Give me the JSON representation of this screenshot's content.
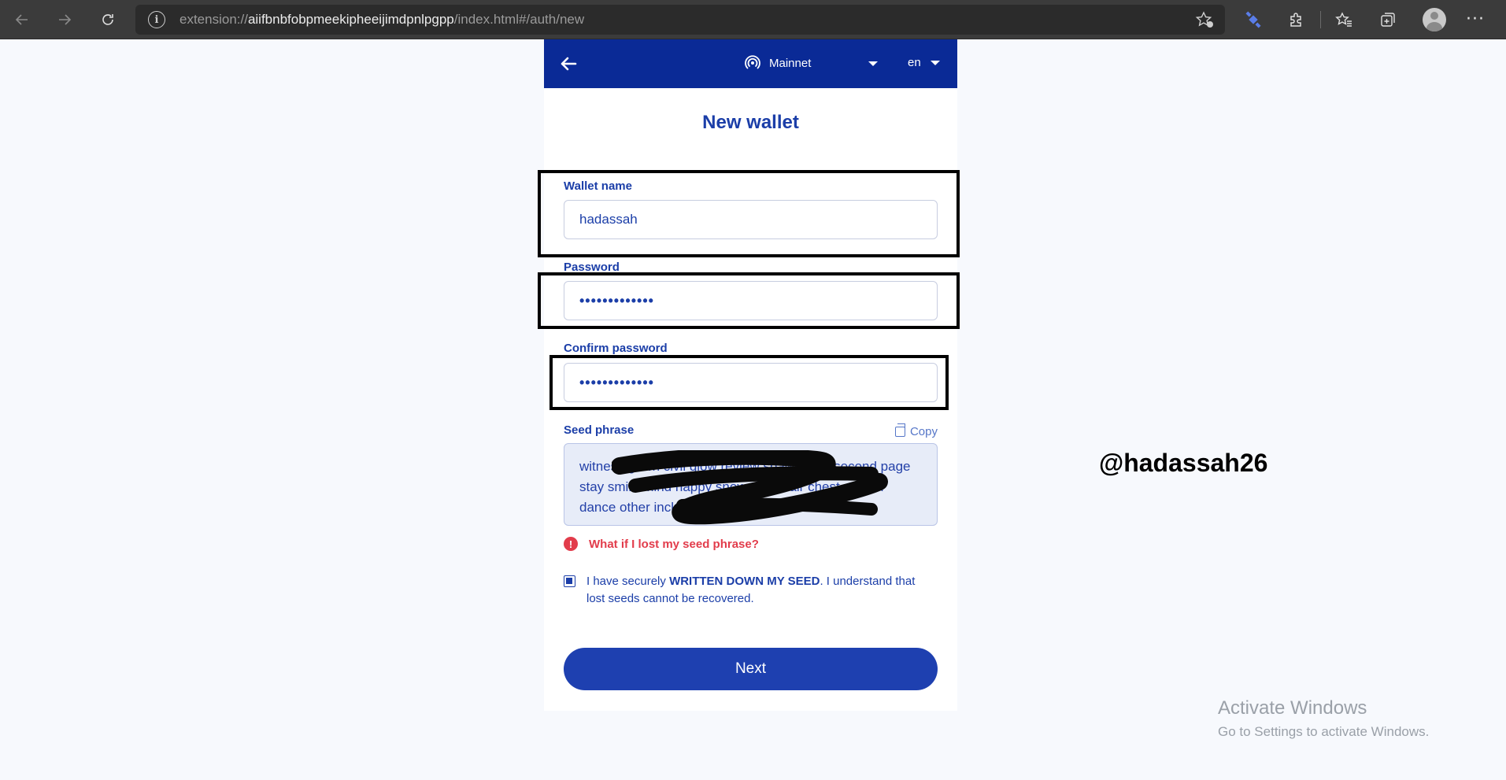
{
  "browser": {
    "url_scheme": "extension://",
    "url_host": "aiifbnbfobpmeekipheeijimdpnlpgpp",
    "url_path": "/index.html#/auth/new"
  },
  "header": {
    "network": "Mainnet",
    "language": "en"
  },
  "form": {
    "title": "New wallet",
    "wallet_name_label": "Wallet name",
    "wallet_name_value": "hadassah",
    "password_label": "Password",
    "password_value": "•••••••••••••",
    "confirm_label": "Confirm password",
    "confirm_value": "•••••••••••••",
    "seed_label": "Seed phrase",
    "copy_label": "Copy",
    "seed_value": "witness gown civil glow review spawn lake second page stay smile mind happy snow two chair chest mother dance other include lamp tank",
    "lost_seed_link": "What if I lost my seed phrase?",
    "checkbox_text_before": "I have securely",
    "checkbox_text_bold": "WRITTEN DOWN MY SEED",
    "checkbox_text_after": ". I understand that lost seeds cannot be recovered.",
    "next_label": "Next"
  },
  "overlay": {
    "handle": "@hadassah26",
    "activate_title": "Activate Windows",
    "activate_sub": "Go to Settings to activate Windows."
  },
  "colors": {
    "brand": "#0a2a96",
    "accent": "#1e40b0",
    "error": "#e23c4b"
  }
}
